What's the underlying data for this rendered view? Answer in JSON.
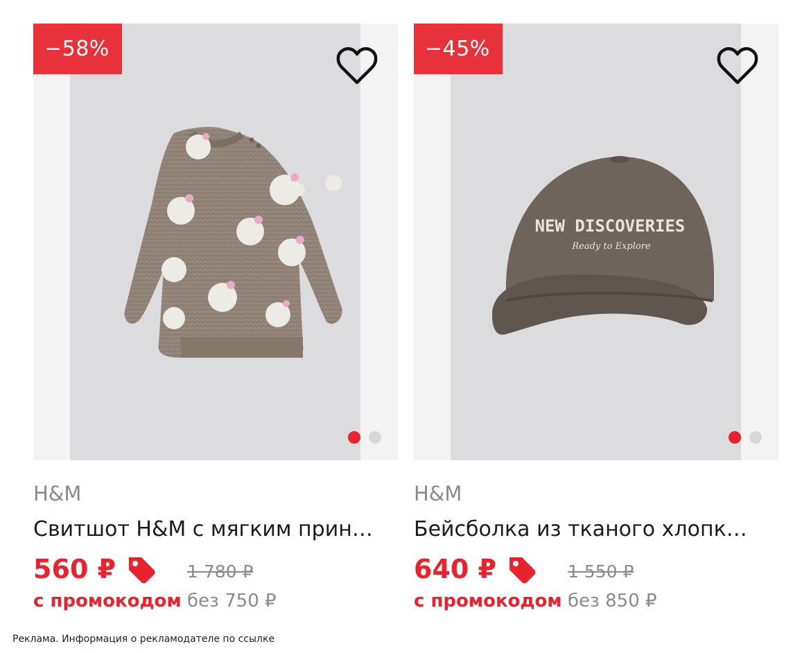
{
  "colors": {
    "accent": "#e8232d",
    "badge": "#e8323b",
    "muted": "#8a8a8e"
  },
  "products": [
    {
      "discount": "−58%",
      "brand": "H&M",
      "title": "Свитшот H&M с мягким прин…",
      "price": "560 ₽",
      "old_price": "1 780 ₽",
      "promo_label": "с промокодом",
      "without_promo": "без 750 ₽",
      "image_icon": "sweatshirt-image",
      "gallery_pages": 2,
      "gallery_current": 1
    },
    {
      "discount": "−45%",
      "brand": "H&M",
      "title": "Бейсболка из тканого хлопк…",
      "price": "640 ₽",
      "old_price": "1 550 ₽",
      "promo_label": "с промокодом",
      "without_promo": "без 850 ₽",
      "image_icon": "cap-image",
      "cap_text": "NEW DISCOVERIES",
      "cap_subtext": "Ready to Explore",
      "gallery_pages": 2,
      "gallery_current": 1
    }
  ],
  "footer": {
    "ad_notice": "Реклама. Информация о рекламодателе по ссылке"
  }
}
